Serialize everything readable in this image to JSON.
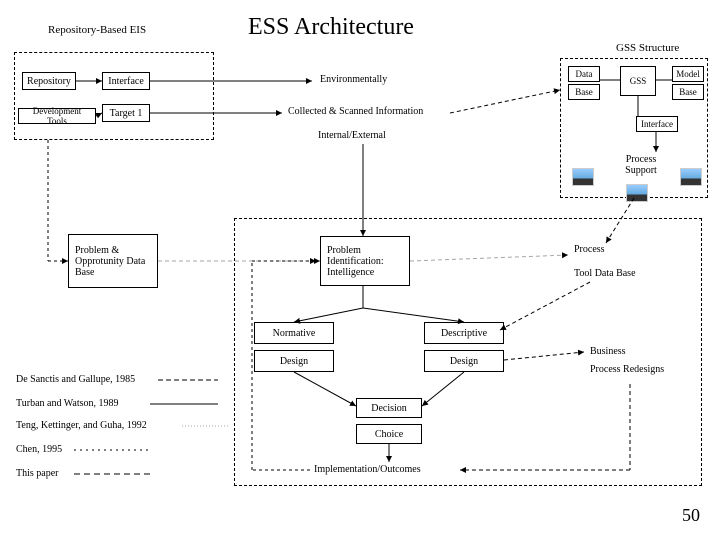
{
  "title": "ESS Architecture",
  "repo": {
    "header": "Repository-Based EIS",
    "repository": "Repository",
    "interface": "Interface",
    "target1": "Target 1",
    "devtools": "Development Tools"
  },
  "gss": {
    "header": "GSS Structure",
    "data": "Data",
    "gss": "GSS",
    "model": "Model",
    "base_left": "Base",
    "base_right": "Base",
    "interface": "Interface",
    "process_support": "Process Support"
  },
  "middle": {
    "env": "Environmentally",
    "collected": "Collected & Scanned Information",
    "intext": "Internal/External"
  },
  "center": {
    "problem_db": "Problem & Opprotunity Data Base",
    "problem_id": "Problem Identification: Intelligence",
    "process": "Process",
    "tool_db": "Tool Data Base",
    "normative": "Normative",
    "descriptive": "Descriptive",
    "design_left": "Design",
    "design_right": "Design",
    "business": "Business",
    "process_redesigns": "Process Redesigns",
    "decision": "Decision",
    "choice": "Choice",
    "impl": "Implementation/Outcomes"
  },
  "citations": {
    "c1": "De Sanctis and Gallupe, 1985",
    "c2": "Turban and Watson, 1989",
    "c3": "Teng, Kettinger, and Guha, 1992",
    "c4": "Chen, 1995",
    "c5": "This paper"
  },
  "page": "50"
}
